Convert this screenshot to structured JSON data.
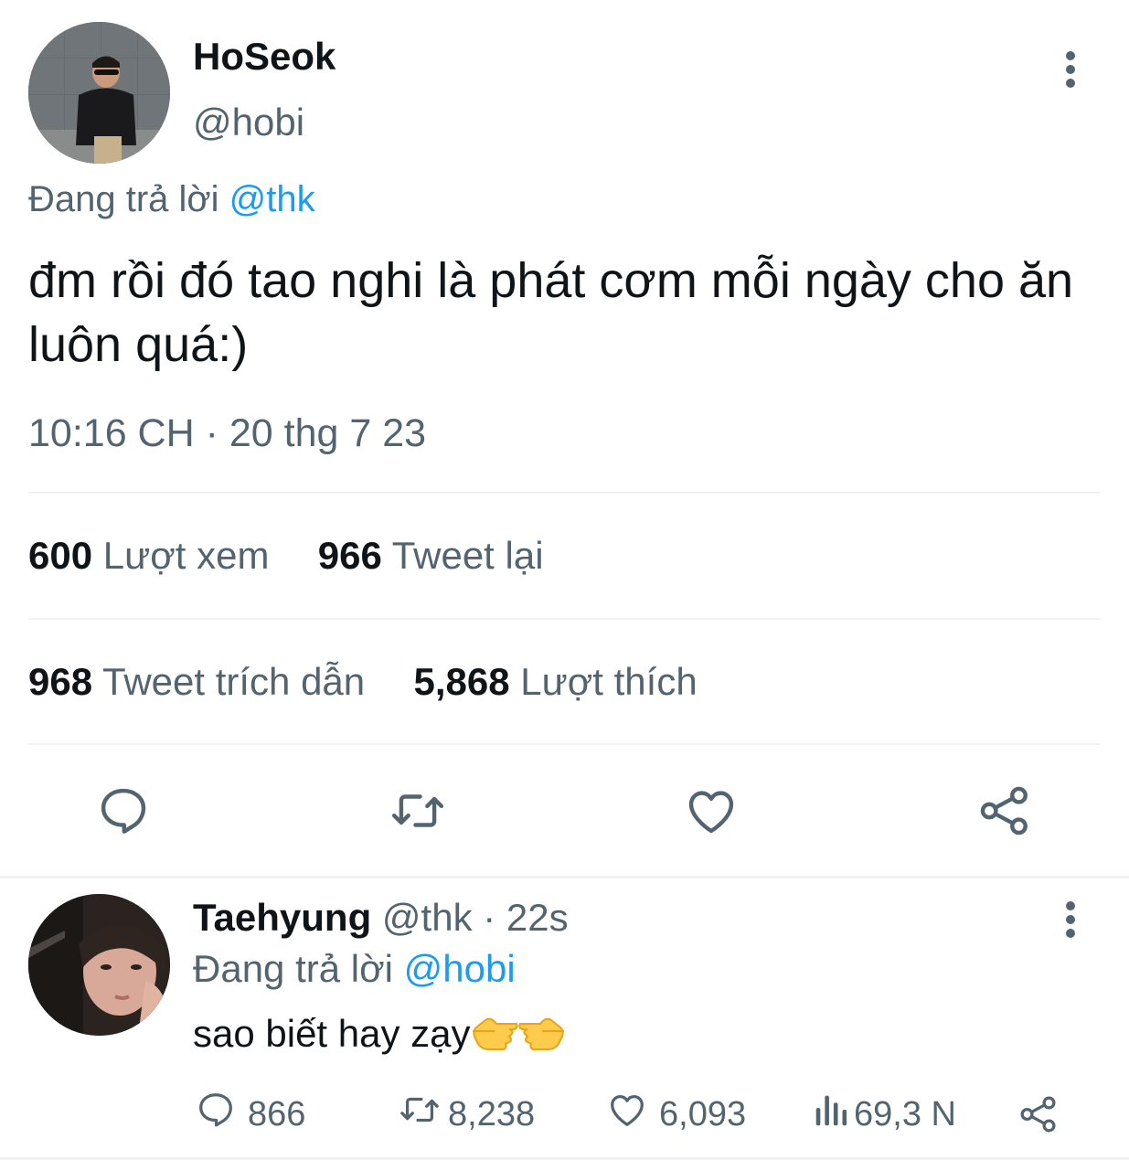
{
  "main_tweet": {
    "display_name": "HoSeok",
    "handle": "@hobi",
    "replying_prefix": "Đang trả lời",
    "replying_to": "@thk",
    "text": "đm rồi đó tao nghi là phát cơm mỗi ngày cho ăn luôn quá:)",
    "timestamp": "10:16 CH · 20 thg 7 23",
    "stats": {
      "views_count": "600",
      "views_label": "Lượt xem",
      "retweets_count": "966",
      "retweets_label": "Tweet lại",
      "quotes_count": "968",
      "quotes_label": "Tweet trích dẫn",
      "likes_count": "5,868",
      "likes_label": "Lượt thích"
    },
    "actions": [
      "reply-icon",
      "retweet-icon",
      "heart-icon",
      "share-icon"
    ]
  },
  "reply_tweet": {
    "display_name": "Taehyung",
    "handle": "@thk",
    "time": "· 22s",
    "replying_prefix": "Đang trả lời",
    "replying_to": "@hobi",
    "text": "sao biết hay zạy",
    "emojis": [
      "backhand-index-pointing-left",
      "backhand-index-pointing-right"
    ],
    "actions": {
      "replies": "866",
      "retweets": "8,238",
      "likes": "6,093",
      "views": "69,3 N"
    }
  },
  "colors": {
    "text_primary": "#0f1419",
    "text_secondary": "#536471",
    "accent": "#1d9bf0",
    "divider": "#eff3f4"
  }
}
